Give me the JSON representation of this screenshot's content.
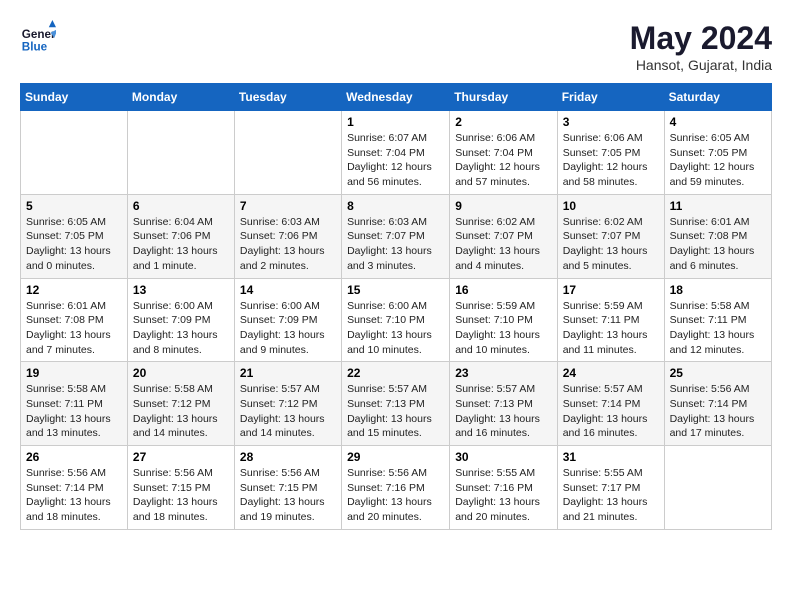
{
  "logo": {
    "line1": "General",
    "line2": "Blue"
  },
  "title": "May 2024",
  "location": "Hansot, Gujarat, India",
  "weekdays": [
    "Sunday",
    "Monday",
    "Tuesday",
    "Wednesday",
    "Thursday",
    "Friday",
    "Saturday"
  ],
  "weeks": [
    [
      {
        "day": "",
        "info": ""
      },
      {
        "day": "",
        "info": ""
      },
      {
        "day": "",
        "info": ""
      },
      {
        "day": "1",
        "info": "Sunrise: 6:07 AM\nSunset: 7:04 PM\nDaylight: 12 hours and 56 minutes."
      },
      {
        "day": "2",
        "info": "Sunrise: 6:06 AM\nSunset: 7:04 PM\nDaylight: 12 hours and 57 minutes."
      },
      {
        "day": "3",
        "info": "Sunrise: 6:06 AM\nSunset: 7:05 PM\nDaylight: 12 hours and 58 minutes."
      },
      {
        "day": "4",
        "info": "Sunrise: 6:05 AM\nSunset: 7:05 PM\nDaylight: 12 hours and 59 minutes."
      }
    ],
    [
      {
        "day": "5",
        "info": "Sunrise: 6:05 AM\nSunset: 7:05 PM\nDaylight: 13 hours and 0 minutes."
      },
      {
        "day": "6",
        "info": "Sunrise: 6:04 AM\nSunset: 7:06 PM\nDaylight: 13 hours and 1 minute."
      },
      {
        "day": "7",
        "info": "Sunrise: 6:03 AM\nSunset: 7:06 PM\nDaylight: 13 hours and 2 minutes."
      },
      {
        "day": "8",
        "info": "Sunrise: 6:03 AM\nSunset: 7:07 PM\nDaylight: 13 hours and 3 minutes."
      },
      {
        "day": "9",
        "info": "Sunrise: 6:02 AM\nSunset: 7:07 PM\nDaylight: 13 hours and 4 minutes."
      },
      {
        "day": "10",
        "info": "Sunrise: 6:02 AM\nSunset: 7:07 PM\nDaylight: 13 hours and 5 minutes."
      },
      {
        "day": "11",
        "info": "Sunrise: 6:01 AM\nSunset: 7:08 PM\nDaylight: 13 hours and 6 minutes."
      }
    ],
    [
      {
        "day": "12",
        "info": "Sunrise: 6:01 AM\nSunset: 7:08 PM\nDaylight: 13 hours and 7 minutes."
      },
      {
        "day": "13",
        "info": "Sunrise: 6:00 AM\nSunset: 7:09 PM\nDaylight: 13 hours and 8 minutes."
      },
      {
        "day": "14",
        "info": "Sunrise: 6:00 AM\nSunset: 7:09 PM\nDaylight: 13 hours and 9 minutes."
      },
      {
        "day": "15",
        "info": "Sunrise: 6:00 AM\nSunset: 7:10 PM\nDaylight: 13 hours and 10 minutes."
      },
      {
        "day": "16",
        "info": "Sunrise: 5:59 AM\nSunset: 7:10 PM\nDaylight: 13 hours and 10 minutes."
      },
      {
        "day": "17",
        "info": "Sunrise: 5:59 AM\nSunset: 7:11 PM\nDaylight: 13 hours and 11 minutes."
      },
      {
        "day": "18",
        "info": "Sunrise: 5:58 AM\nSunset: 7:11 PM\nDaylight: 13 hours and 12 minutes."
      }
    ],
    [
      {
        "day": "19",
        "info": "Sunrise: 5:58 AM\nSunset: 7:11 PM\nDaylight: 13 hours and 13 minutes."
      },
      {
        "day": "20",
        "info": "Sunrise: 5:58 AM\nSunset: 7:12 PM\nDaylight: 13 hours and 14 minutes."
      },
      {
        "day": "21",
        "info": "Sunrise: 5:57 AM\nSunset: 7:12 PM\nDaylight: 13 hours and 14 minutes."
      },
      {
        "day": "22",
        "info": "Sunrise: 5:57 AM\nSunset: 7:13 PM\nDaylight: 13 hours and 15 minutes."
      },
      {
        "day": "23",
        "info": "Sunrise: 5:57 AM\nSunset: 7:13 PM\nDaylight: 13 hours and 16 minutes."
      },
      {
        "day": "24",
        "info": "Sunrise: 5:57 AM\nSunset: 7:14 PM\nDaylight: 13 hours and 16 minutes."
      },
      {
        "day": "25",
        "info": "Sunrise: 5:56 AM\nSunset: 7:14 PM\nDaylight: 13 hours and 17 minutes."
      }
    ],
    [
      {
        "day": "26",
        "info": "Sunrise: 5:56 AM\nSunset: 7:14 PM\nDaylight: 13 hours and 18 minutes."
      },
      {
        "day": "27",
        "info": "Sunrise: 5:56 AM\nSunset: 7:15 PM\nDaylight: 13 hours and 18 minutes."
      },
      {
        "day": "28",
        "info": "Sunrise: 5:56 AM\nSunset: 7:15 PM\nDaylight: 13 hours and 19 minutes."
      },
      {
        "day": "29",
        "info": "Sunrise: 5:56 AM\nSunset: 7:16 PM\nDaylight: 13 hours and 20 minutes."
      },
      {
        "day": "30",
        "info": "Sunrise: 5:55 AM\nSunset: 7:16 PM\nDaylight: 13 hours and 20 minutes."
      },
      {
        "day": "31",
        "info": "Sunrise: 5:55 AM\nSunset: 7:17 PM\nDaylight: 13 hours and 21 minutes."
      },
      {
        "day": "",
        "info": ""
      }
    ]
  ]
}
